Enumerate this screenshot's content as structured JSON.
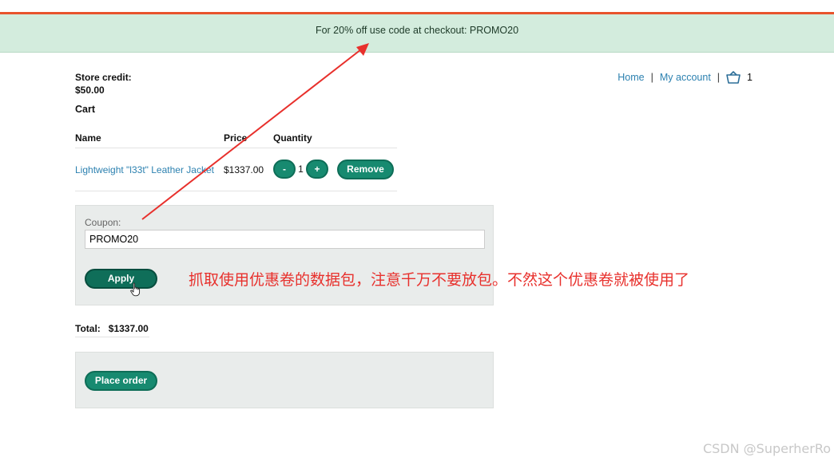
{
  "notice": {
    "text": "For 20% off use code at checkout: PROMO20"
  },
  "nav": {
    "home": "Home",
    "my_account": "My account",
    "separator": "|",
    "cart_count": "1",
    "cart_icon": "basket-icon"
  },
  "store_credit": {
    "label": "Store credit:",
    "value": "$50.00"
  },
  "cart": {
    "heading": "Cart",
    "columns": [
      "Name",
      "Price",
      "Quantity"
    ],
    "items": [
      {
        "name": "Lightweight \"l33t\" Leather Jacket",
        "price": "$1337.00",
        "quantity": "1",
        "minus_label": "-",
        "plus_label": "+",
        "remove_label": "Remove"
      }
    ]
  },
  "coupon": {
    "label": "Coupon:",
    "value": "PROMO20",
    "apply_label": "Apply"
  },
  "total": {
    "label": "Total:",
    "value": "$1337.00"
  },
  "order": {
    "place_order_label": "Place order"
  },
  "annotation": {
    "text": "抓取使用优惠卷的数据包，注意千万不要放包。不然这个优惠卷就被使用了",
    "color": "#e8302c"
  },
  "watermark": {
    "text": "CSDN @SuperherRo"
  },
  "colors": {
    "accent": "#178a70",
    "notice_bg": "#d3ecdd",
    "link": "#2c81b0",
    "top_bar": "#e8532c"
  }
}
